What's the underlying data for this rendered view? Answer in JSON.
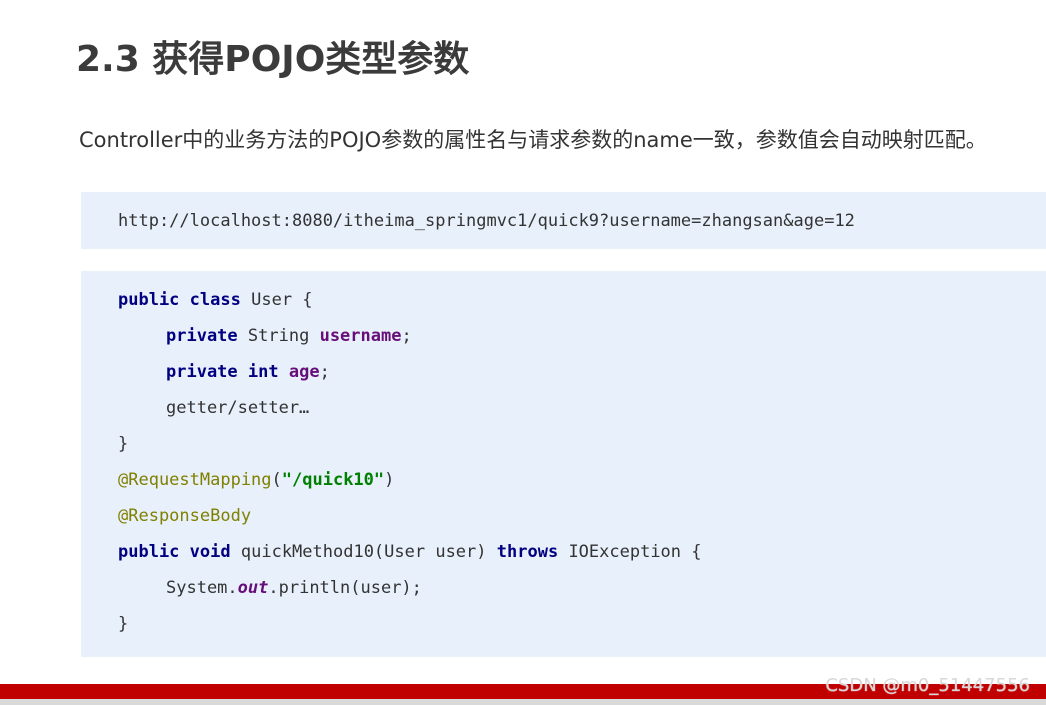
{
  "heading": {
    "title": "2.3 获得POJO类型参数"
  },
  "description": {
    "text": "Controller中的业务方法的POJO参数的属性名与请求参数的name一致，参数值会自动映射匹配。"
  },
  "url_block": {
    "url": "http://localhost:8080/itheima_springmvc1/quick9?username=zhangsan&age=12"
  },
  "code_block": {
    "line1": {
      "kw_public": "public",
      "kw_class": "class",
      "rest": "User {"
    },
    "line2": {
      "kw_private": "private",
      "type": "String",
      "field": "username",
      "semicolon": ";"
    },
    "line3": {
      "kw_private": "private",
      "kw_int": "int",
      "field": "age",
      "semicolon": ";"
    },
    "line4": {
      "text": "getter/setter…"
    },
    "line5": {
      "text": "}"
    },
    "line6": {
      "annotation": "@RequestMapping",
      "open": "(",
      "string": "\"/quick10\"",
      "close": ")"
    },
    "line7": {
      "annotation": "@ResponseBody"
    },
    "line8": {
      "kw_public": "public",
      "kw_void": "void",
      "signature": "quickMethod10(User user)",
      "kw_throws": "throws",
      "rest": "IOException {"
    },
    "line9": {
      "prefix": "System.",
      "static_field": "out",
      "suffix": ".println(user);"
    },
    "line10": {
      "text": "}"
    }
  },
  "footer": {
    "accent_color": "#c00000",
    "watermark": "CSDN @m0_51447556"
  }
}
